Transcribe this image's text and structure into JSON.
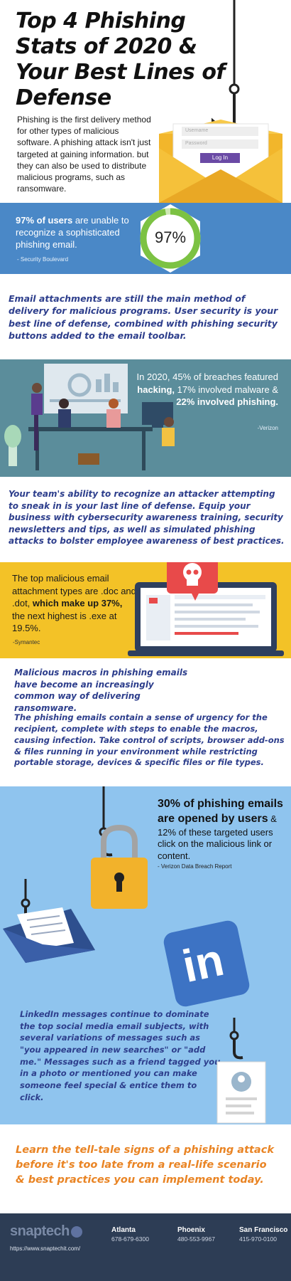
{
  "header": {
    "title": "Top 4 Phishing Stats of 2020 & Your Best Lines of Defense",
    "intro": "Phishing is the first delivery method for other types of malicious software. A phishing attack isn't just targeted at gaining information. but they can also be used to distribute malicious programs, such as ransomware."
  },
  "login_form": {
    "username_placeholder": "Username",
    "password_placeholder": "Password",
    "button_label": "Log In"
  },
  "stat1": {
    "highlight": "97% of users",
    "text": " are unable to recognize a sophisticated phishing email.",
    "source": "- Security Boulevard",
    "badge": "97%",
    "percent": 97
  },
  "attachments_text": "Email attachments are still the main method of delivery for malicious programs. User security is your best line of defense, combined with phishing security buttons added to the email toolbar.",
  "stat2": {
    "part1": "In 2020, 45% of breaches featured ",
    "hacking": "hacking,",
    "part2": " 17% involved malware & ",
    "bold2": "22% involved phishing.",
    "source": "-Verizon"
  },
  "team_text": "Your team's ability to recognize an attacker attempting to sneak in is your last line of defense. Equip your business with cybersecurity awareness training, security newsletters and tips, as well as simulated phishing attacks to bolster employee awareness of best practices.",
  "stat3": {
    "part1": "The top malicious email attachment types are .doc and .dot, ",
    "bold": "which make up 37%,",
    "part2": " the next highest is .exe at 19.5%.",
    "source": "-Symantec"
  },
  "macros": {
    "lead": "Malicious macros in phishing emails have become an increasingly common way of delivering ransomware.",
    "body": "The phishing emails contain a sense of urgency for the recipient, complete with steps to enable the macros, causing infection. Take control of scripts, browser add-ons & files running in your environment while restricting portable storage, devices & specific files or file types."
  },
  "stat4": {
    "bold": "30% of phishing emails are opened by users",
    "text": " & 12% of these targeted users click on the malicious link or content.",
    "source": "- Verizon Data Breach Report"
  },
  "linkedin": {
    "logo": "in",
    "text": "LinkedIn messages continue to dominate the top social media email subjects, with several variations of messages such as \"you appeared in new searches\" or \"add me.\" Messages such as a friend tagged you in a photo or mentioned you can make someone feel special & entice them to click."
  },
  "cta": "Learn the tell-tale signs of a phishing attack before it's too late from a real-life scenario & best practices you can implement today.",
  "footer": {
    "logo": "snaptech",
    "url": "https://www.snaptechit.com/",
    "offices": [
      {
        "city": "Atlanta",
        "phone": "678-679-6300"
      },
      {
        "city": "Phoenix",
        "phone": "480-553-9967"
      },
      {
        "city": "San Francisco",
        "phone": "415-970-0100"
      }
    ]
  },
  "colors": {
    "blue_band": "#4a88c7",
    "teal_band": "#5b8d9b",
    "yellow_band": "#f3c227",
    "light_blue_band": "#8fc4ee",
    "navy_text": "#2d3e8c",
    "orange_text": "#e98424",
    "footer_bg": "#2d3d55"
  }
}
